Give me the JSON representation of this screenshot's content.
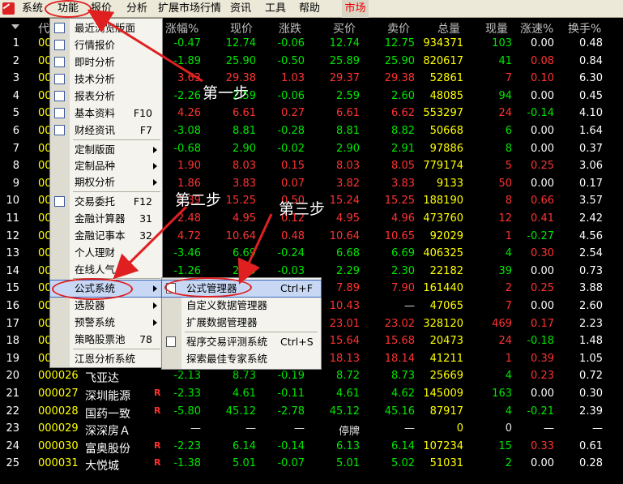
{
  "menubar": {
    "items": [
      "系统",
      "功能",
      "报价",
      "分析",
      "扩展市场行情",
      "资讯",
      "工具",
      "帮助"
    ],
    "active_tab": "市场"
  },
  "table": {
    "headers": {
      "code": "代",
      "change_pct": "涨幅%",
      "price": "现价",
      "change": "涨跌",
      "bid": "买价",
      "ask": "卖价",
      "volume": "总量",
      "cur_vol": "现量",
      "speed": "涨速%",
      "turnover": "换手%"
    },
    "rows": [
      {
        "idx": "1",
        "code": "00",
        "name": "",
        "flag": "",
        "chg_pct": "-0.47",
        "price": "12.74",
        "chg": "-0.06",
        "bid": "12.74",
        "ask": "12.75",
        "vol": "934371",
        "cur": "103",
        "speed": "0.00",
        "turn": "0.48"
      },
      {
        "idx": "2",
        "code": "00",
        "name": "",
        "flag": "",
        "chg_pct": "-1.89",
        "price": "25.90",
        "chg": "-0.50",
        "bid": "25.89",
        "ask": "25.90",
        "vol": "820617",
        "cur": "41",
        "speed": "0.08",
        "turn": "0.84"
      },
      {
        "idx": "3",
        "code": "00",
        "name": "",
        "flag": "",
        "chg_pct": "3.63",
        "price": "29.38",
        "chg": "1.03",
        "bid": "29.37",
        "ask": "29.38",
        "vol": "52861",
        "cur": "7",
        "speed": "0.10",
        "turn": "6.30"
      },
      {
        "idx": "4",
        "code": "00",
        "name": "",
        "flag": "",
        "chg_pct": "-2.26",
        "price": "2.59",
        "chg": "-0.06",
        "bid": "2.59",
        "ask": "2.60",
        "vol": "48085",
        "cur": "94",
        "speed": "0.00",
        "turn": "0.45"
      },
      {
        "idx": "5",
        "code": "00",
        "name": "",
        "flag": "",
        "chg_pct": "4.26",
        "price": "6.61",
        "chg": "0.27",
        "bid": "6.61",
        "ask": "6.62",
        "vol": "553297",
        "cur": "24",
        "speed": "-0.14",
        "turn": "4.10"
      },
      {
        "idx": "6",
        "code": "00",
        "name": "",
        "flag": "",
        "chg_pct": "-3.08",
        "price": "8.81",
        "chg": "-0.28",
        "bid": "8.81",
        "ask": "8.82",
        "vol": "50668",
        "cur": "6",
        "speed": "0.00",
        "turn": "1.64"
      },
      {
        "idx": "7",
        "code": "00",
        "name": "",
        "flag": "",
        "chg_pct": "-0.68",
        "price": "2.90",
        "chg": "-0.02",
        "bid": "2.90",
        "ask": "2.91",
        "vol": "97886",
        "cur": "8",
        "speed": "0.00",
        "turn": "0.37"
      },
      {
        "idx": "8",
        "code": "00",
        "name": "",
        "flag": "",
        "chg_pct": "1.90",
        "price": "8.03",
        "chg": "0.15",
        "bid": "8.03",
        "ask": "8.05",
        "vol": "779174",
        "cur": "5",
        "speed": "0.25",
        "turn": "3.06"
      },
      {
        "idx": "9",
        "code": "00",
        "name": "",
        "flag": "",
        "chg_pct": "1.86",
        "price": "3.83",
        "chg": "0.07",
        "bid": "3.82",
        "ask": "3.83",
        "vol": "9133",
        "cur": "50",
        "speed": "0.00",
        "turn": "0.17"
      },
      {
        "idx": "10",
        "code": "00",
        "name": "",
        "flag": "",
        "chg_pct": "3.39",
        "price": "15.25",
        "chg": "0.50",
        "bid": "15.24",
        "ask": "15.25",
        "vol": "188190",
        "cur": "8",
        "speed": "0.66",
        "turn": "3.57"
      },
      {
        "idx": "11",
        "code": "00",
        "name": "",
        "flag": "",
        "chg_pct": "2.48",
        "price": "4.95",
        "chg": "0.12",
        "bid": "4.95",
        "ask": "4.96",
        "vol": "473760",
        "cur": "12",
        "speed": "0.41",
        "turn": "2.42"
      },
      {
        "idx": "12",
        "code": "00",
        "name": "",
        "flag": "",
        "chg_pct": "4.72",
        "price": "10.64",
        "chg": "0.48",
        "bid": "10.64",
        "ask": "10.65",
        "vol": "92029",
        "cur": "1",
        "speed": "-0.27",
        "turn": "4.56"
      },
      {
        "idx": "13",
        "code": "00",
        "name": "",
        "flag": "",
        "chg_pct": "-3.46",
        "price": "6.69",
        "chg": "-0.24",
        "bid": "6.68",
        "ask": "6.69",
        "vol": "406325",
        "cur": "4",
        "speed": "0.30",
        "turn": "2.54"
      },
      {
        "idx": "14",
        "code": "00",
        "name": "",
        "flag": "",
        "chg_pct": "-1.26",
        "price": "2.29",
        "chg": "-0.03",
        "bid": "2.29",
        "ask": "2.30",
        "vol": "22182",
        "cur": "39",
        "speed": "0.00",
        "turn": "0.73"
      },
      {
        "idx": "15",
        "code": "00",
        "name": "",
        "flag": "",
        "chg_pct": "",
        "price": "",
        "chg": "",
        "bid": "7.89",
        "ask": "7.90",
        "vol": "161440",
        "cur": "2",
        "speed": "0.25",
        "turn": "3.88"
      },
      {
        "idx": "16",
        "code": "00",
        "name": "",
        "flag": "",
        "chg_pct": "",
        "price": "",
        "chg": "",
        "bid": "10.43",
        "ask": "—",
        "vol": "47065",
        "cur": "7",
        "speed": "0.00",
        "turn": "2.60"
      },
      {
        "idx": "17",
        "code": "00",
        "name": "",
        "flag": "",
        "chg_pct": "",
        "price": "",
        "chg": "",
        "bid": "23.01",
        "ask": "23.02",
        "vol": "328120",
        "cur": "469",
        "speed": "0.17",
        "turn": "2.23"
      },
      {
        "idx": "18",
        "code": "00",
        "name": "",
        "flag": "",
        "chg_pct": "",
        "price": "",
        "chg": "",
        "bid": "15.64",
        "ask": "15.68",
        "vol": "20473",
        "cur": "24",
        "speed": "-0.18",
        "turn": "1.48"
      },
      {
        "idx": "19",
        "code": "00",
        "name": "",
        "flag": "R",
        "chg_pct": "",
        "price": "",
        "chg": "",
        "bid": "18.13",
        "ask": "18.14",
        "vol": "41211",
        "cur": "1",
        "speed": "0.39",
        "turn": "1.05"
      },
      {
        "idx": "20",
        "code": "000026",
        "name": "飞亚达",
        "flag": "",
        "chg_pct": "-2.13",
        "price": "8.73",
        "chg": "-0.19",
        "bid": "8.72",
        "ask": "8.73",
        "vol": "25669",
        "cur": "4",
        "speed": "0.23",
        "turn": "0.72"
      },
      {
        "idx": "21",
        "code": "000027",
        "name": "深圳能源",
        "flag": "R",
        "chg_pct": "-2.33",
        "price": "4.61",
        "chg": "-0.11",
        "bid": "4.61",
        "ask": "4.62",
        "vol": "145009",
        "cur": "163",
        "speed": "0.00",
        "turn": "0.30"
      },
      {
        "idx": "22",
        "code": "000028",
        "name": "国药一致",
        "flag": "R",
        "chg_pct": "-5.80",
        "price": "45.12",
        "chg": "-2.78",
        "bid": "45.12",
        "ask": "45.16",
        "vol": "87917",
        "cur": "4",
        "speed": "-0.21",
        "turn": "2.39"
      },
      {
        "idx": "23",
        "code": "000029",
        "name": "深深房Ａ",
        "flag": "",
        "chg_pct": "—",
        "price": "—",
        "chg": "—",
        "bid": "停牌",
        "ask": "—",
        "vol": "0",
        "cur": "0",
        "speed": "—",
        "turn": "—"
      },
      {
        "idx": "24",
        "code": "000030",
        "name": "富奥股份",
        "flag": "R",
        "chg_pct": "-2.23",
        "price": "6.14",
        "chg": "-0.14",
        "bid": "6.13",
        "ask": "6.14",
        "vol": "107234",
        "cur": "15",
        "speed": "0.33",
        "turn": "0.61"
      },
      {
        "idx": "25",
        "code": "000031",
        "name": "大悦城",
        "flag": "R",
        "chg_pct": "-1.38",
        "price": "5.01",
        "chg": "-0.07",
        "bid": "5.01",
        "ask": "5.02",
        "vol": "51031",
        "cur": "2",
        "speed": "0.00",
        "turn": "0.28"
      }
    ]
  },
  "dropdown": {
    "items": [
      {
        "label": "最近浏览版面",
        "shortcut": "",
        "arrow": false,
        "icon": "layout-icon"
      },
      {
        "label": "行情报价",
        "shortcut": "",
        "arrow": false,
        "icon": "quote-table-icon"
      },
      {
        "label": "即时分析",
        "shortcut": "",
        "arrow": false,
        "icon": "line-chart-icon"
      },
      {
        "label": "技术分析",
        "shortcut": "",
        "arrow": false,
        "icon": "candlestick-icon"
      },
      {
        "label": "报表分析",
        "shortcut": "",
        "arrow": false,
        "icon": "report-icon"
      },
      {
        "label": "基本资料",
        "shortcut": "F10",
        "arrow": false,
        "icon": "f10-icon"
      },
      {
        "label": "财经资讯",
        "shortcut": "F7",
        "arrow": false,
        "icon": "news-icon"
      },
      {
        "label": "定制版面",
        "shortcut": "",
        "arrow": true,
        "icon": ""
      },
      {
        "label": "定制品种",
        "shortcut": "",
        "arrow": true,
        "icon": ""
      },
      {
        "label": "期权分析",
        "shortcut": "",
        "arrow": true,
        "icon": ""
      },
      {
        "label": "交易委托",
        "shortcut": "F12",
        "arrow": false,
        "icon": "f12-icon"
      },
      {
        "label": "金融计算器",
        "shortcut": "31",
        "arrow": false,
        "icon": ""
      },
      {
        "label": "金融记事本",
        "shortcut": "32",
        "arrow": false,
        "icon": ""
      },
      {
        "label": "个人理财",
        "shortcut": "",
        "arrow": false,
        "icon": ""
      },
      {
        "label": "在线人气",
        "shortcut": "",
        "arrow": false,
        "icon": ""
      },
      {
        "label": "公式系统",
        "shortcut": "",
        "arrow": true,
        "icon": ""
      },
      {
        "label": "选股器",
        "shortcut": "",
        "arrow": true,
        "icon": ""
      },
      {
        "label": "预警系统",
        "shortcut": "",
        "arrow": true,
        "icon": ""
      },
      {
        "label": "策略股票池",
        "shortcut": "78",
        "arrow": false,
        "icon": ""
      },
      {
        "label": "江恩分析系统",
        "shortcut": "",
        "arrow": false,
        "icon": ""
      }
    ]
  },
  "submenu": {
    "items": [
      {
        "label": "公式管理器",
        "shortcut": "Ctrl+F",
        "icon": "formula-icon"
      },
      {
        "label": "自定义数据管理器",
        "shortcut": "",
        "icon": ""
      },
      {
        "label": "扩展数据管理器",
        "shortcut": "",
        "icon": ""
      },
      {
        "label": "程序交易评测系统",
        "shortcut": "Ctrl+S",
        "icon": "clipboard-icon"
      },
      {
        "label": "探索最佳专家系统",
        "shortcut": "",
        "icon": ""
      }
    ]
  },
  "annotations": {
    "step1": "第一步",
    "step2": "第二步",
    "step3": "第三步",
    "color": "#e02020"
  }
}
